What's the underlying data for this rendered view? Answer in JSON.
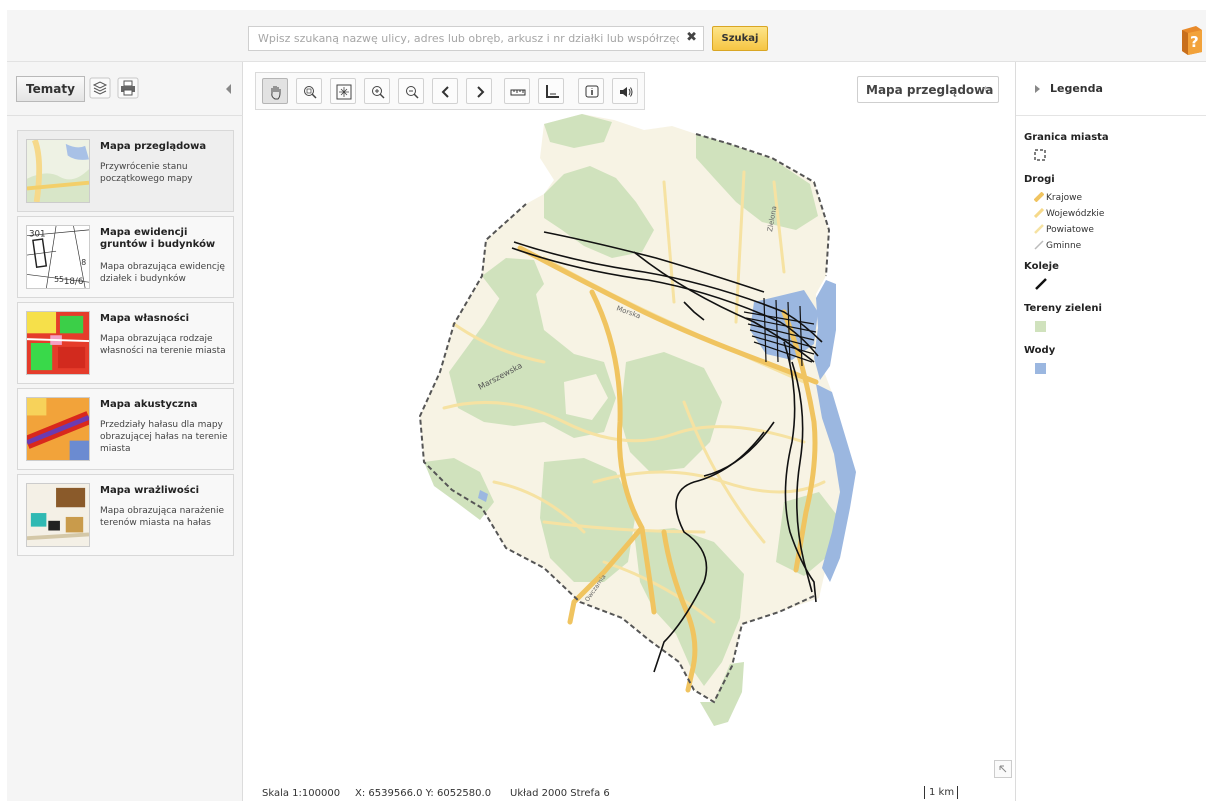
{
  "search": {
    "placeholder": "Wpisz szukaną nazwę ulicy, adres lub obręb, arkusz i nr działki lub współrzędne",
    "clear_symbol": "✖",
    "button_label": "Szukaj"
  },
  "left_panel": {
    "tab_label": "Tematy",
    "themes": [
      {
        "title": "Mapa przeglądowa",
        "description": "Przywrócenie stanu początkowego mapy"
      },
      {
        "title": "Mapa ewidencji gruntów i budynków",
        "description": "Mapa obrazująca ewidencję działek i budynków"
      },
      {
        "title": "Mapa własności",
        "description": "Mapa obrazująca rodzaje własności na terenie miasta"
      },
      {
        "title": "Mapa akustyczna",
        "description": "Przedziały hałasu dla mapy obrazującej hałas na terenie miasta"
      },
      {
        "title": "Mapa wrażliwości",
        "description": "Mapa obrazująca narażenie terenów miasta na hałas"
      }
    ],
    "thumb_texts": {
      "ewidencja_a": "301",
      "ewidencja_b": "55",
      "ewidencja_c": "18/6",
      "ewidencja_d": "8"
    }
  },
  "map": {
    "basemap_label": "Mapa przeglądowa",
    "basemap_arrow": "÷",
    "street_labels": {
      "marszewska": "Marszewska",
      "morska": "Morska",
      "zielona": "Zielona",
      "owczarnia": "Owczarnia"
    }
  },
  "toolbar": {
    "tools": [
      "pan",
      "zoom-window",
      "zoom-extent",
      "zoom-in",
      "zoom-out",
      "previous-view",
      "next-view",
      "measure-distance",
      "measure-area",
      "identify",
      "speaker"
    ]
  },
  "status_bar": {
    "scale": "Skala 1:100000",
    "coordinates": "X: 6539566.0 Y: 6052580.0",
    "crs": "Układ 2000 Strefa 6",
    "scale_bar_label": "1 km"
  },
  "legend": {
    "title": "Legenda",
    "sections": {
      "city_boundary": "Granica miasta",
      "roads": "Drogi",
      "railways": "Koleje",
      "green": "Tereny zieleni",
      "water": "Wody"
    },
    "roads": [
      "Krajowe",
      "Wojewódzkie",
      "Powiatowe",
      "Gminne"
    ]
  },
  "colors": {
    "green_area": "#cfe0bd",
    "water": "#9bb7e0",
    "national_road": "#f0c460",
    "local_road": "#f6e2a2",
    "railway": "#111111",
    "boundary": "#555555",
    "accent_button": "#f6c543"
  },
  "icons": {
    "help": "help-book-icon",
    "layers": "layers-icon",
    "print": "printer-icon"
  }
}
